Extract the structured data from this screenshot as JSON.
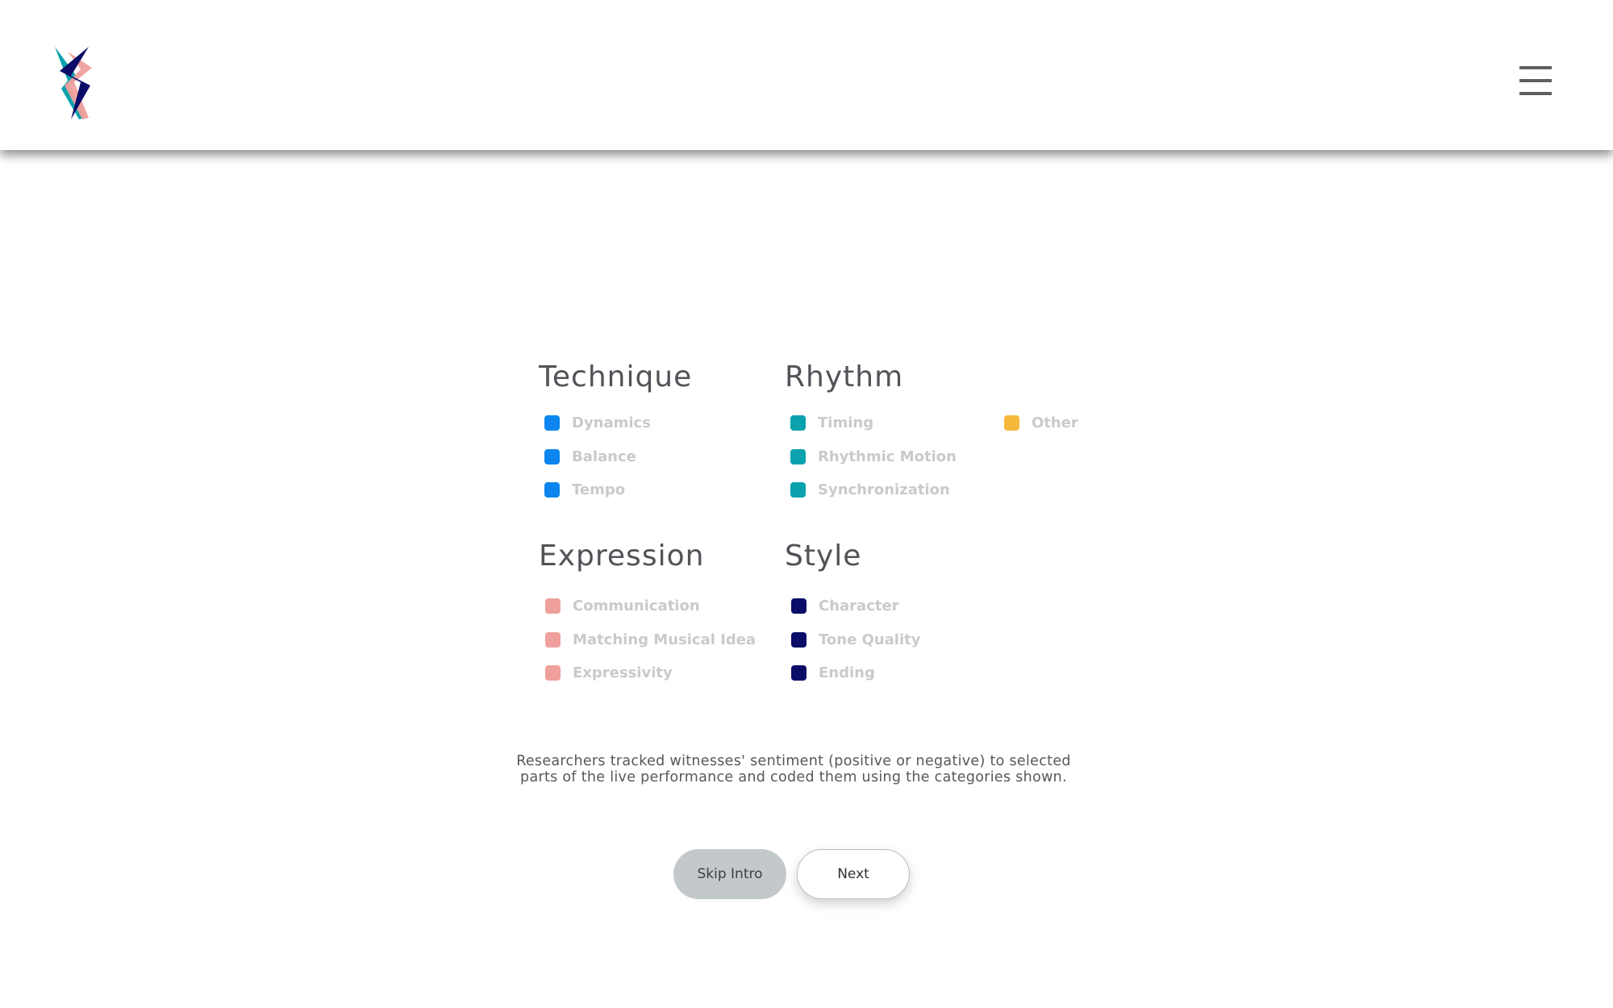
{
  "header": {
    "logo_icon": "lightning-bolt-logo-icon",
    "menu_icon": "hamburger-menu-icon"
  },
  "groups": [
    {
      "title": "Technique",
      "color": "#0c86ee",
      "items": [
        "Dynamics",
        "Balance",
        "Tempo"
      ]
    },
    {
      "title": "Rhythm",
      "color": "#0aa2ad",
      "items": [
        "Timing",
        "Rhythmic Motion",
        "Synchronization"
      ]
    },
    {
      "title": "",
      "color": "#f5b83b",
      "items": [
        "Other"
      ]
    },
    {
      "title": "Expression",
      "color": "#f0a09c",
      "items": [
        "Communication",
        "Matching Musical Idea",
        "Expressivity"
      ]
    },
    {
      "title": "Style",
      "color": "#0a0c68",
      "items": [
        "Character",
        "Tone Quality",
        "Ending"
      ]
    }
  ],
  "caption": {
    "line1": "Researchers tracked witnesses' sentiment (positive or negative)  to selected",
    "line2": "parts of the live performance and coded them using the categories shown."
  },
  "buttons": {
    "skip_label": "Skip Intro",
    "next_label": "Next"
  }
}
